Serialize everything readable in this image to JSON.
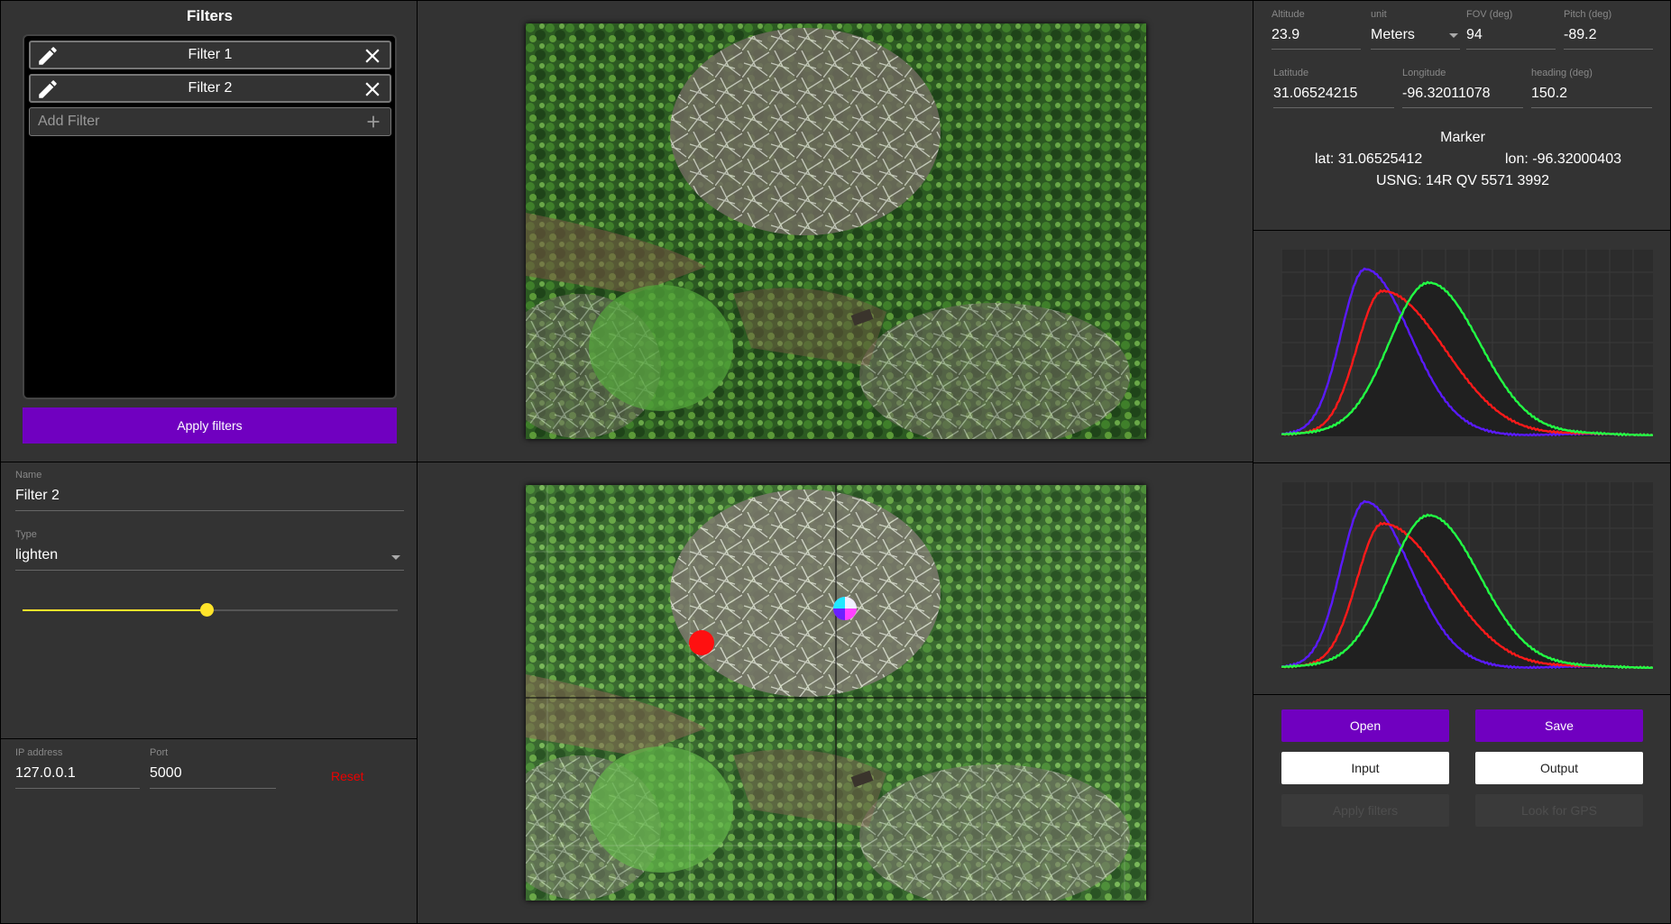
{
  "filters": {
    "title": "Filters",
    "items": [
      {
        "label": "Filter 1"
      },
      {
        "label": "Filter 2"
      }
    ],
    "add_placeholder": "Add Filter",
    "apply_label": "Apply filters"
  },
  "editor": {
    "name_label": "Name",
    "name_value": "Filter 2",
    "type_label": "Type",
    "type_value": "lighten",
    "slider_value": 0.49
  },
  "network": {
    "ip_label": "IP address",
    "ip_value": "127.0.0.1",
    "port_label": "Port",
    "port_value": "5000",
    "reset_label": "Reset"
  },
  "geo": {
    "altitude_label": "Altitude",
    "altitude_value": "23.9",
    "unit_label": "unit",
    "unit_value": "Meters",
    "fov_label": "FOV (deg)",
    "fov_value": "94",
    "pitch_label": "Pitch (deg)",
    "pitch_value": "-89.2",
    "latitude_label": "Latitude",
    "latitude_value": "31.06524215",
    "longitude_label": "Longitude",
    "longitude_value": "-96.32011078",
    "heading_label": "heading (deg)",
    "heading_value": "150.2",
    "marker_title": "Marker",
    "marker_lat": "lat: 31.06525412",
    "marker_lon": "lon: -96.32000403",
    "marker_usng": "USNG: 14R QV 5571 3992"
  },
  "buttons": {
    "open": "Open",
    "save": "Save",
    "input": "Input",
    "output": "Output",
    "apply_filters": "Apply filters",
    "look_for_gps": "Look for GPS"
  },
  "colors": {
    "accent": "#7000c0",
    "slider": "#ffe42a",
    "reset": "#ee0000",
    "hist_blue": "#5a1aff",
    "hist_red": "#ff1a1a",
    "hist_green": "#22ff44"
  }
}
